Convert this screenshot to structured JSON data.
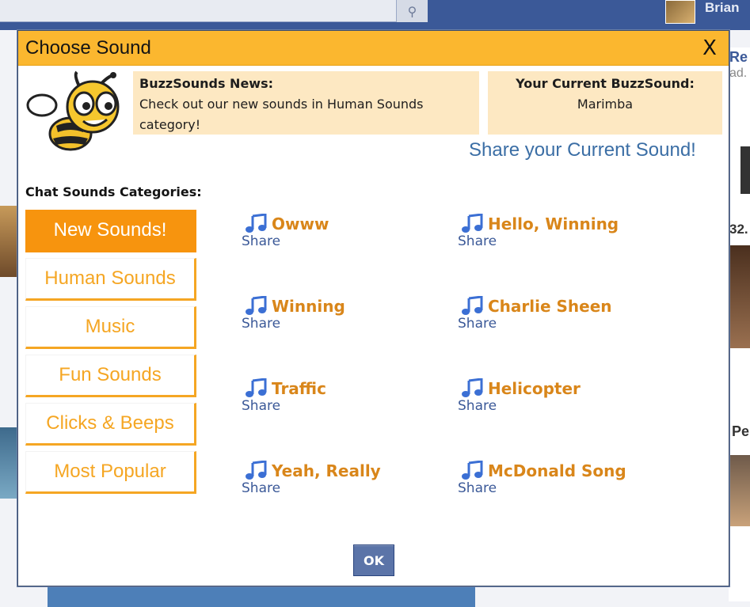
{
  "background": {
    "search_icon": "search-icon",
    "username": "Brian",
    "right_text_1": "Re",
    "right_text_2": "ad.",
    "right_number": "32.",
    "right_text_3": "Pe"
  },
  "dialog": {
    "title": "Choose Sound",
    "close_label": "X"
  },
  "news": {
    "title": "BuzzSounds News:",
    "body": "Check out our new sounds in Human Sounds category!"
  },
  "current": {
    "title": "Your Current BuzzSound:",
    "value": "Marimba"
  },
  "share_current_label": "Share your Current Sound!",
  "categories": {
    "heading": "Chat Sounds Categories:",
    "items": [
      {
        "label": "New Sounds!",
        "active": true
      },
      {
        "label": "Human Sounds",
        "active": false
      },
      {
        "label": "Music",
        "active": false
      },
      {
        "label": "Fun Sounds",
        "active": false
      },
      {
        "label": "Clicks & Beeps",
        "active": false
      },
      {
        "label": "Most Popular",
        "active": false
      }
    ]
  },
  "sounds": [
    {
      "name": "Owww",
      "share": "Share"
    },
    {
      "name": "Hello, Winning",
      "share": "Share"
    },
    {
      "name": "Winning",
      "share": "Share"
    },
    {
      "name": "Charlie Sheen",
      "share": "Share"
    },
    {
      "name": "Traffic",
      "share": "Share"
    },
    {
      "name": "Helicopter",
      "share": "Share"
    },
    {
      "name": "Yeah, Really",
      "share": "Share"
    },
    {
      "name": "McDonald Song",
      "share": "Share"
    }
  ],
  "ok_label": "OK",
  "colors": {
    "header": "#fbb72f",
    "accent": "#f7940e",
    "sound_name": "#d9861a",
    "link": "#3b5998",
    "note_icon": "#3b6fd4"
  }
}
